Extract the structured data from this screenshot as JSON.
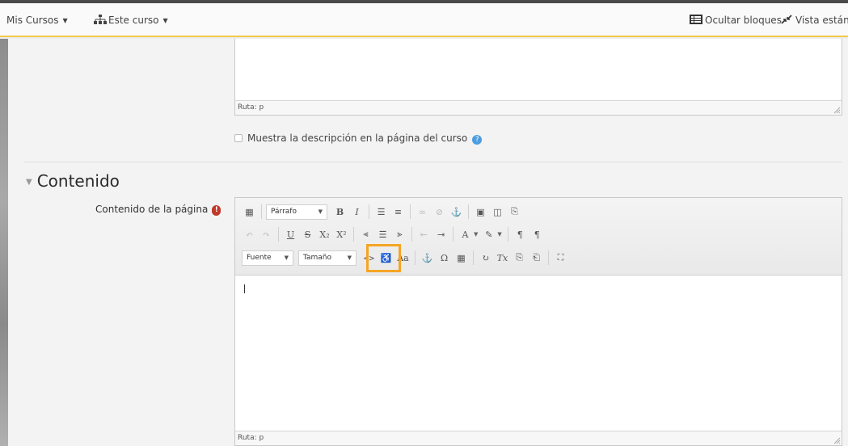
{
  "nav": {
    "my_courses": "Mis Cursos",
    "this_course": "Este curso",
    "hide_blocks": "Ocultar bloques",
    "standard_view": "Vista estánd"
  },
  "description_editor": {
    "path_label": "Ruta: p"
  },
  "show_description": {
    "label": "Muestra la descripción en la página del curso",
    "checked": false
  },
  "section": {
    "title": "Contenido"
  },
  "content_field": {
    "label": "Contenido de la página",
    "required": true,
    "toolbar": {
      "paragraph_format": "Párrafo",
      "font": "Fuente",
      "size": "Tamaño",
      "highlighted_button": "html-source-icon"
    },
    "path_label": "Ruta: p"
  },
  "colors": {
    "nav_accent": "#f2c94c",
    "highlight_box": "#f5a524",
    "required": "#c0392b",
    "help": "#4d9de0"
  }
}
